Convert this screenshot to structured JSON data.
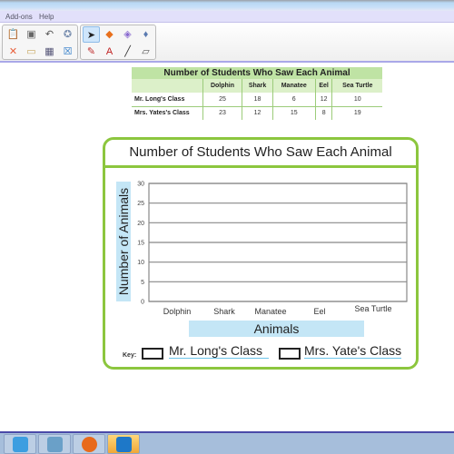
{
  "menubar": {
    "items": [
      {
        "label": "Add-ons"
      },
      {
        "label": "Help"
      }
    ]
  },
  "toolbar": {
    "group1": [
      {
        "name": "paste-icon",
        "glyph": "📋"
      },
      {
        "name": "screenshot-icon",
        "glyph": "▣"
      },
      {
        "name": "undo-icon",
        "glyph": "↶"
      },
      {
        "name": "magic-icon",
        "glyph": "✪"
      },
      {
        "name": "delete-icon",
        "glyph": "✕"
      },
      {
        "name": "screen-shade-icon",
        "glyph": "▭"
      },
      {
        "name": "table-icon",
        "glyph": "▦"
      },
      {
        "name": "close-box-icon",
        "glyph": "☒"
      }
    ],
    "group2": [
      {
        "name": "select-arrow-icon",
        "glyph": "➤",
        "selected": true
      },
      {
        "name": "shapes-icon",
        "glyph": "◆"
      },
      {
        "name": "eraser-icon",
        "glyph": "◈"
      },
      {
        "name": "fill-icon",
        "glyph": "♦"
      },
      {
        "name": "pens-icon",
        "glyph": "✎"
      },
      {
        "name": "text-icon",
        "glyph": "A"
      },
      {
        "name": "line-icon",
        "glyph": "╱"
      },
      {
        "name": "eraser-block-icon",
        "glyph": "▱"
      }
    ]
  },
  "table": {
    "title": "Number of Students Who Saw Each Animal",
    "columns": [
      "",
      "Dolphin",
      "Shark",
      "Manatee",
      "Eel",
      "Sea Turtle"
    ],
    "rows": [
      {
        "label": "Mr. Long's Class",
        "values": [
          "25",
          "18",
          "6",
          "12",
          "10"
        ]
      },
      {
        "label": "Mrs. Yates's Class",
        "values": [
          "23",
          "12",
          "15",
          "8",
          "19"
        ]
      }
    ]
  },
  "chart_data": {
    "type": "bar",
    "title": "Number of Students Who Saw Each Animal",
    "xlabel": "Animals",
    "ylabel": "Number of Animals",
    "categories": [
      "Dolphin",
      "Shark",
      "Manatee",
      "Eel",
      "Sea Turtle"
    ],
    "yticks": [
      0,
      5,
      10,
      15,
      20,
      25,
      30
    ],
    "ylim": [
      0,
      30
    ],
    "grid": true,
    "series": [
      {
        "name": "Mr. Long's Class",
        "values": []
      },
      {
        "name": "Mrs. Yate's Class",
        "values": []
      }
    ],
    "legend": {
      "label": "Key:",
      "placement": "bottom"
    }
  },
  "taskbar": {
    "items": [
      {
        "name": "notebook-app-icon",
        "color": "#3d9ee0",
        "active": false
      },
      {
        "name": "document-camera-icon",
        "color": "#6aa0c8",
        "active": false
      },
      {
        "name": "firefox-icon",
        "color": "#e86a1c",
        "active": false
      },
      {
        "name": "community-app-icon",
        "color": "#1e78c8",
        "active": true
      }
    ]
  }
}
